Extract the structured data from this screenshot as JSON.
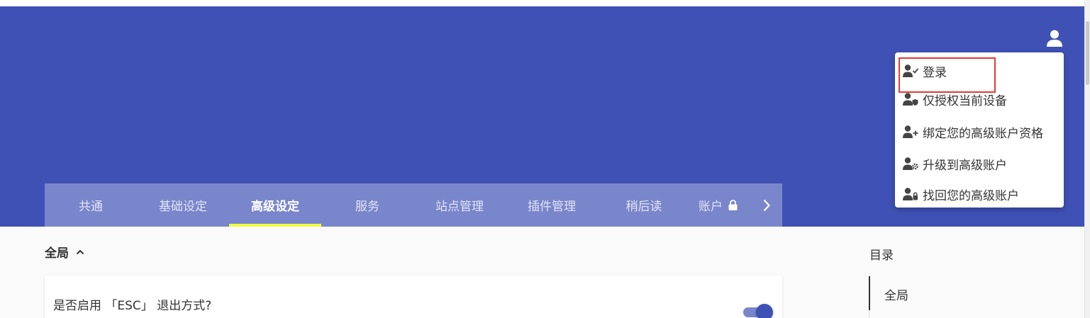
{
  "header": {
    "background": "#3f51b5",
    "user_icon": "account-circle-icon"
  },
  "tabs": {
    "items": [
      {
        "label": "共通"
      },
      {
        "label": "基础设定"
      },
      {
        "label": "高级设定",
        "active": true
      },
      {
        "label": "服务"
      },
      {
        "label": "站点管理"
      },
      {
        "label": "插件管理"
      },
      {
        "label": "稍后读"
      },
      {
        "label": "账户",
        "icon": "lock-icon"
      }
    ],
    "next_icon": "chevron-right-icon",
    "indicator_color": "#eeff41"
  },
  "account_menu": {
    "items": [
      {
        "label": "登录",
        "icon": "account-check-icon"
      },
      {
        "label": "仅授权当前设备",
        "icon": "account-shield-icon"
      },
      {
        "label": "绑定您的高级账户资格",
        "icon": "account-plus-icon"
      },
      {
        "label": "升级到高级账户",
        "icon": "account-cog-icon"
      },
      {
        "label": "找回您的高级账户",
        "icon": "account-lock-icon"
      }
    ]
  },
  "section": {
    "title": "全局",
    "chevron_icon": "chevron-up-icon",
    "settings": [
      {
        "label": "是否启用 「ESC」 退出方式?",
        "enabled": true
      }
    ]
  },
  "toc": {
    "title": "目录",
    "items": [
      {
        "label": "全局"
      }
    ]
  }
}
